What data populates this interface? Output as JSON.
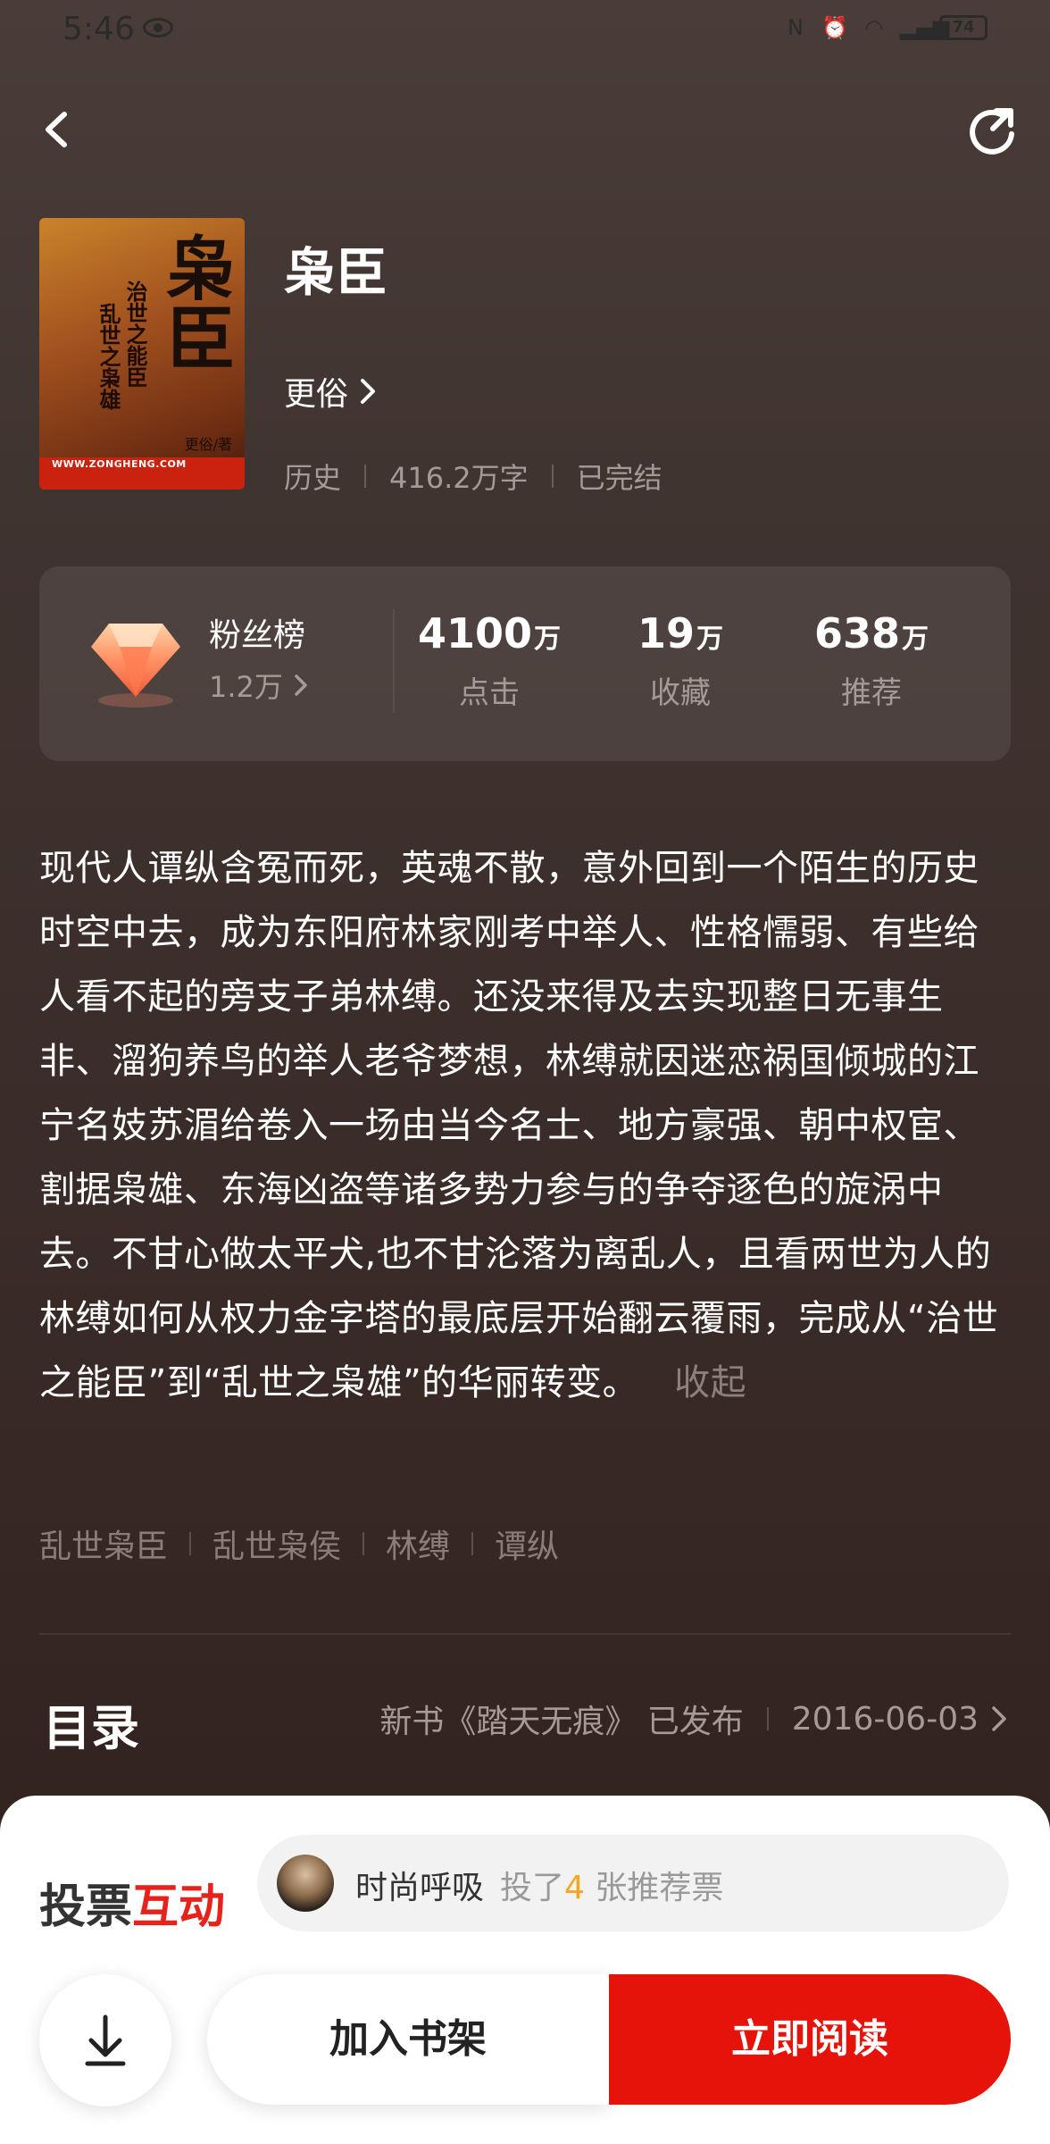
{
  "status": {
    "time": "5:46",
    "battery": "74",
    "network": "4G"
  },
  "book": {
    "title": "枭臣",
    "author": "更俗",
    "category": "历史",
    "words": "416.2万字",
    "state": "已完结",
    "cover": {
      "big_title": "枭臣",
      "subtitle_1": "治世之能臣",
      "subtitle_2": "乱世之枭雄",
      "author": "更俗/著",
      "url": "WWW.ZONGHENG.COM"
    }
  },
  "stats": {
    "fans_label": "粉丝榜",
    "fans_value": "1.2万",
    "items": [
      {
        "num": "4100",
        "unit": "万",
        "label": "点击"
      },
      {
        "num": "19",
        "unit": "万",
        "label": "收藏"
      },
      {
        "num": "638",
        "unit": "万",
        "label": "推荐"
      }
    ]
  },
  "description": "现代人谭纵含冤而死，英魂不散，意外回到一个陌生的历史时空中去，成为东阳府林家刚考中举人、性格懦弱、有些给人看不起的旁支子弟林缚。还没来得及去实现整日无事生非、溜狗养鸟的举人老爷梦想，林缚就因迷恋祸国倾城的江宁名妓苏湄给卷入一场由当今名士、地方豪强、朝中权宦、割据枭雄、东海凶盗等诸多势力参与的争夺逐色的旋涡中去。不甘心做太平犬,也不甘沦落为离乱人，且看两世为人的林缚如何从权力金字塔的最底层开始翻云覆雨，完成从“治世之能臣”到“乱世之枭雄”的华丽转变。",
  "collapse_label": "收起",
  "tags": [
    "乱世枭臣",
    "乱世枭侯",
    "林缚",
    "谭纵"
  ],
  "toc": {
    "title": "目录",
    "latest": "新书《踏天无痕》 已发布",
    "date": "2016-06-03"
  },
  "vote": {
    "title_a": "投票",
    "title_b": "互动",
    "user": "时尚呼吸",
    "text_before": "投了",
    "count": "4",
    "text_after": " 张推荐票"
  },
  "actions": {
    "shelf": "加入书架",
    "read": "立即阅读"
  },
  "colors": {
    "accent": "#e5130a",
    "vote_count": "#f5a623"
  }
}
